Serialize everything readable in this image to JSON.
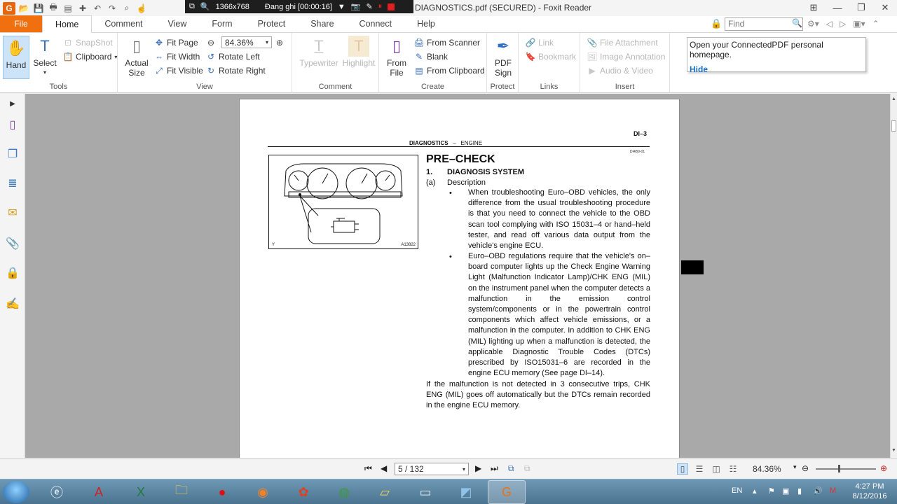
{
  "window": {
    "title": "DIAGNOSTICS.pdf (SECURED) - Foxit Reader",
    "recorder_resolution": "1366x768",
    "recorder_status": "Đang ghi [00:00:16]"
  },
  "tabs": {
    "file": "File",
    "items": [
      "Home",
      "Comment",
      "View",
      "Form",
      "Protect",
      "Share",
      "Connect",
      "Help"
    ],
    "active": "Home",
    "find_placeholder": "Find"
  },
  "ribbon": {
    "tools": {
      "hand": "Hand",
      "select": "Select",
      "snapshot": "SnapShot",
      "clipboard": "Clipboard",
      "label": "Tools"
    },
    "view": {
      "actual_size_1": "Actual",
      "actual_size_2": "Size",
      "fit_page": "Fit Page",
      "fit_width": "Fit Width",
      "fit_visible": "Fit Visible",
      "zoom": "84.36%",
      "rotate_left": "Rotate Left",
      "rotate_right": "Rotate Right",
      "label": "View"
    },
    "comment": {
      "typewriter": "Typewriter",
      "highlight": "Highlight",
      "label": "Comment"
    },
    "create": {
      "from_file_1": "From",
      "from_file_2": "File",
      "from_scanner": "From Scanner",
      "blank": "Blank",
      "from_clipboard": "From Clipboard",
      "label": "Create"
    },
    "protect": {
      "pdf_sign_1": "PDF",
      "pdf_sign_2": "Sign",
      "label": "Protect"
    },
    "links": {
      "link": "Link",
      "bookmark": "Bookmark",
      "label": "Links"
    },
    "insert": {
      "file_attachment": "File Attachment",
      "image_annotation": "Image Annotation",
      "audio_video": "Audio & Video",
      "label": "Insert"
    }
  },
  "popup": {
    "text": "Open your ConnectedPDF personal homepage.",
    "hide": "Hide"
  },
  "document": {
    "header_right": "DI–3",
    "header_left": "DIAGNOSTICS",
    "header_dash": "–",
    "header_sub": "ENGINE",
    "doc_code": "DI4B9-01",
    "title": "PRE–CHECK",
    "section_num": "1.",
    "section_title": "DIAGNOSIS SYSTEM",
    "sub_num": "(a)",
    "sub_title": "Description",
    "bullets": [
      "When troubleshooting Euro–OBD vehicles, the only difference from the usual troubleshooting procedure is that you need to connect the vehicle to the OBD scan tool complying with ISO 15031–4 or hand–held tester, and read off various data output from the vehicle's engine ECU.",
      "Euro–OBD regulations require that the vehicle's on–board computer lights up the Check Engine Warning Light (Malfunction Indicator Lamp)/CHK ENG (MIL) on the instrument panel when the computer detects a malfunction in the emission control system/components or in the powertrain control components which affect vehicle emissions, or a malfunction in the computer. In addition to CHK ENG (MIL) lighting up when a malfunction is detected, the applicable Diagnostic Trouble Codes (DTCs) prescribed by ISO15031–6 are recorded in the engine ECU memory (See page DI–14)."
    ],
    "closing": "If the malfunction is not detected in 3 consecutive trips, CHK ENG (MIL) goes off automatically but the DTCs remain recorded in the engine ECU memory.",
    "figure_letter": "Y",
    "figure_id": "A13822"
  },
  "statusbar": {
    "page": "5 / 132",
    "zoom": "84.36%"
  },
  "taskbar": {
    "lang": "EN",
    "time": "4:27 PM",
    "date": "8/12/2016"
  }
}
